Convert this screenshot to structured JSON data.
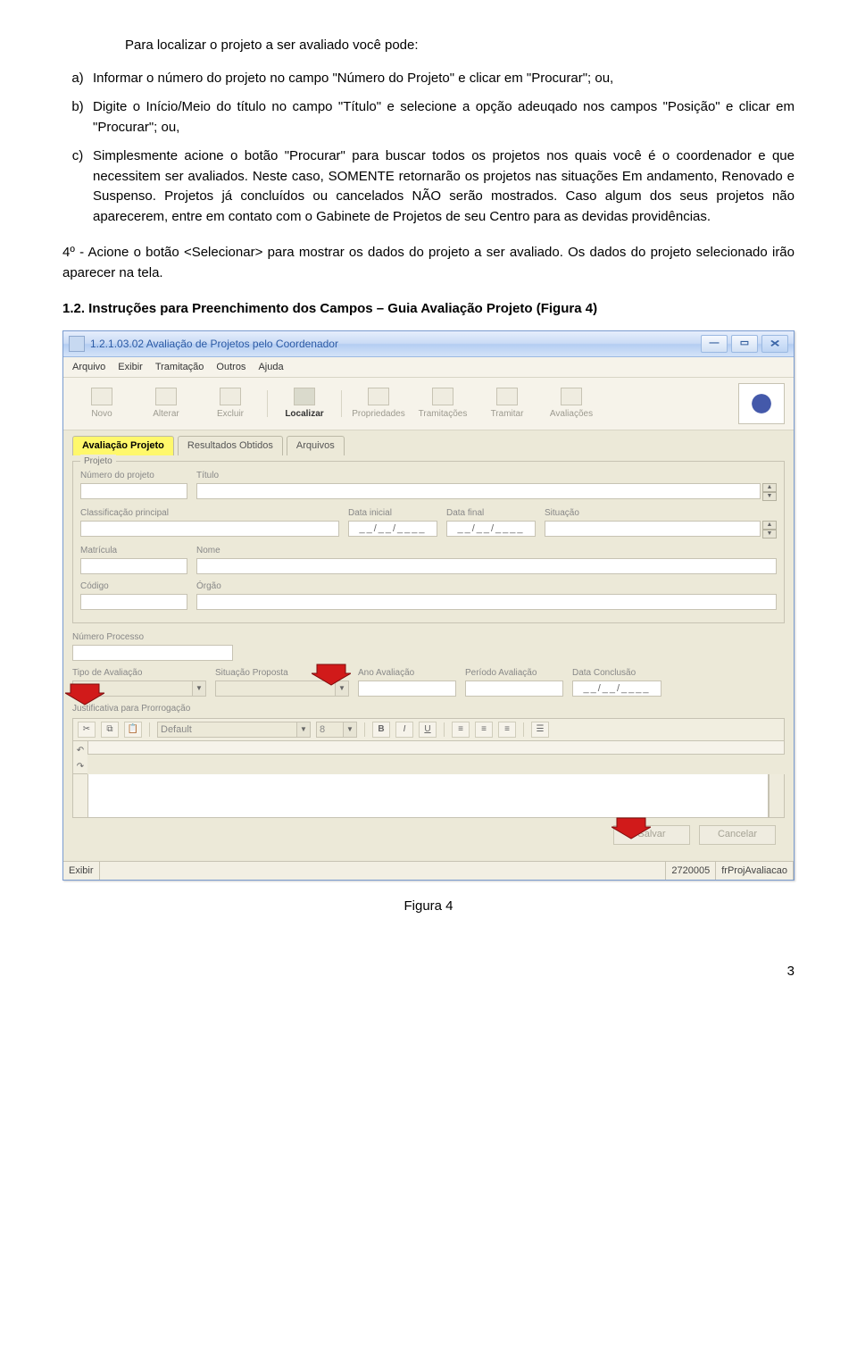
{
  "intro": "Para localizar o projeto a ser avaliado você pode:",
  "list": {
    "a_marker": "a)",
    "a_text": "Informar o número do projeto no campo \"Número do Projeto\" e clicar em \"Procurar\"; ou,",
    "b_marker": "b)",
    "b_text": "Digite o Início/Meio do título no campo \"Título\" e selecione a opção adeuqado nos campos \"Posição\" e clicar em \"Procurar\"; ou,",
    "c_marker": "c)",
    "c_text": "Simplesmente acione o botão \"Procurar\" para buscar todos os projetos nos quais você é o coordenador e que necessitem ser avaliados. Neste caso, SOMENTE retornarão os projetos nas situações Em andamento, Renovado e Suspenso. Projetos já concluídos ou cancelados NÃO serão mostrados. Caso algum dos seus projetos não aparecerem, entre em contato com o Gabinete de Projetos de seu Centro para as devidas providências."
  },
  "para4": "4º - Acione o botão <Selecionar> para mostrar os dados do projeto a ser avaliado. Os dados do projeto selecionado irão aparecer na tela.",
  "section_head": "1.2.  Instruções para Preenchimento dos Campos – Guia Avaliação Projeto (Figura 4)",
  "window": {
    "title": "1.2.1.03.02 Avaliação de Projetos pelo Coordenador",
    "menu": {
      "arquivo": "Arquivo",
      "exibir": "Exibir",
      "tramitacao": "Tramitação",
      "outros": "Outros",
      "ajuda": "Ajuda"
    },
    "toolbar": {
      "novo": "Novo",
      "alterar": "Alterar",
      "excluir": "Excluir",
      "localizar": "Localizar",
      "propriedades": "Propriedades",
      "tramitacoes": "Tramitações",
      "tramitar": "Tramitar",
      "avaliacoes": "Avaliações"
    },
    "tabs": {
      "avaliacao": "Avaliação Projeto",
      "resultados": "Resultados Obtidos",
      "arquivos": "Arquivos"
    },
    "group": {
      "projeto": "Projeto",
      "numero_projeto": "Número do projeto",
      "titulo": "Título",
      "classif": "Classificação principal",
      "data_inicial": "Data inicial",
      "data_final": "Data final",
      "situacao": "Situação",
      "matricula": "Matrícula",
      "nome": "Nome",
      "codigo": "Código",
      "orgao": "Órgão"
    },
    "labels": {
      "numero_processo": "Número Processo",
      "tipo_avaliacao": "Tipo de Avaliação",
      "situacao_proposta": "Situação Proposta",
      "ano_avaliacao": "Ano Avaliação",
      "periodo_avaliacao": "Período Avaliação",
      "data_conclusao": "Data Conclusão",
      "justificativa": "Justificativa para Prorrogação"
    },
    "date_placeholder": "__/__/____",
    "rich": {
      "font": "Default",
      "size": "8"
    },
    "buttons": {
      "salvar": "Salvar",
      "cancelar": "Cancelar"
    },
    "status": {
      "mode": "Exibir",
      "code": "2720005",
      "form": "frProjAvaliacao"
    }
  },
  "figure_caption": "Figura 4",
  "page_number": "3"
}
